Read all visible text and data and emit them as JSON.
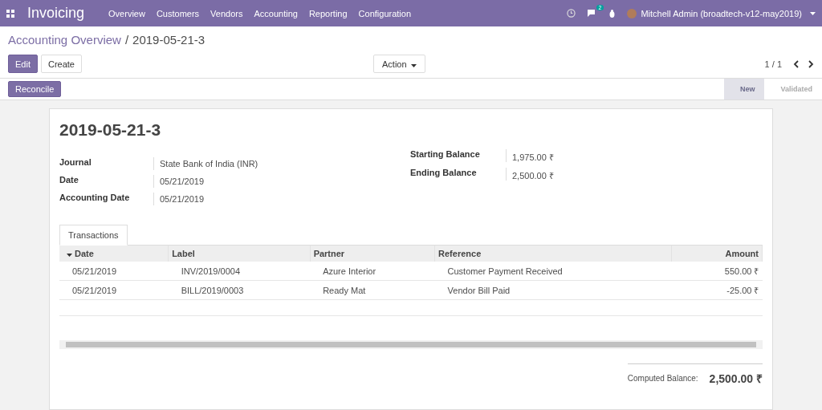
{
  "navbar": {
    "app": "Invoicing",
    "menus": [
      "Overview",
      "Customers",
      "Vendors",
      "Accounting",
      "Reporting",
      "Configuration"
    ],
    "chat_count": "2",
    "user": "Mitchell Admin (broadtech-v12-may2019)"
  },
  "breadcrumb": {
    "parent": "Accounting Overview",
    "separator": "/",
    "current": "2019-05-21-3"
  },
  "buttons": {
    "edit": "Edit",
    "create": "Create",
    "action": "Action"
  },
  "pager": "1 / 1",
  "reconcile": "Reconcile",
  "stages": [
    {
      "label": "New",
      "selected": true
    },
    {
      "label": "Validated",
      "selected": false
    }
  ],
  "title": "2019-05-21-3",
  "left_fields": [
    {
      "label": "Journal",
      "value": "State Bank of India (INR)"
    },
    {
      "label": "Date",
      "value": "05/21/2019"
    },
    {
      "label": "Accounting Date",
      "value": "05/21/2019"
    }
  ],
  "right_fields": [
    {
      "label": "Starting Balance",
      "value": "1,975.00 ₹"
    },
    {
      "label": "Ending Balance",
      "value": "2,500.00 ₹"
    }
  ],
  "tabs": [
    {
      "label": "Transactions",
      "selected": true
    }
  ],
  "table": {
    "columns": [
      "Date",
      "Label",
      "Partner",
      "Reference",
      "Amount"
    ],
    "rows": [
      [
        "05/21/2019",
        "INV/2019/0004",
        "Azure Interior",
        "Customer Payment Received",
        "550.00 ₹"
      ],
      [
        "05/21/2019",
        "BILL/2019/0003",
        "Ready Mat",
        "Vendor Bill Paid",
        "-25.00 ₹"
      ]
    ]
  },
  "computed": {
    "label": "Computed Balance:",
    "value": "2,500.00 ₹"
  }
}
